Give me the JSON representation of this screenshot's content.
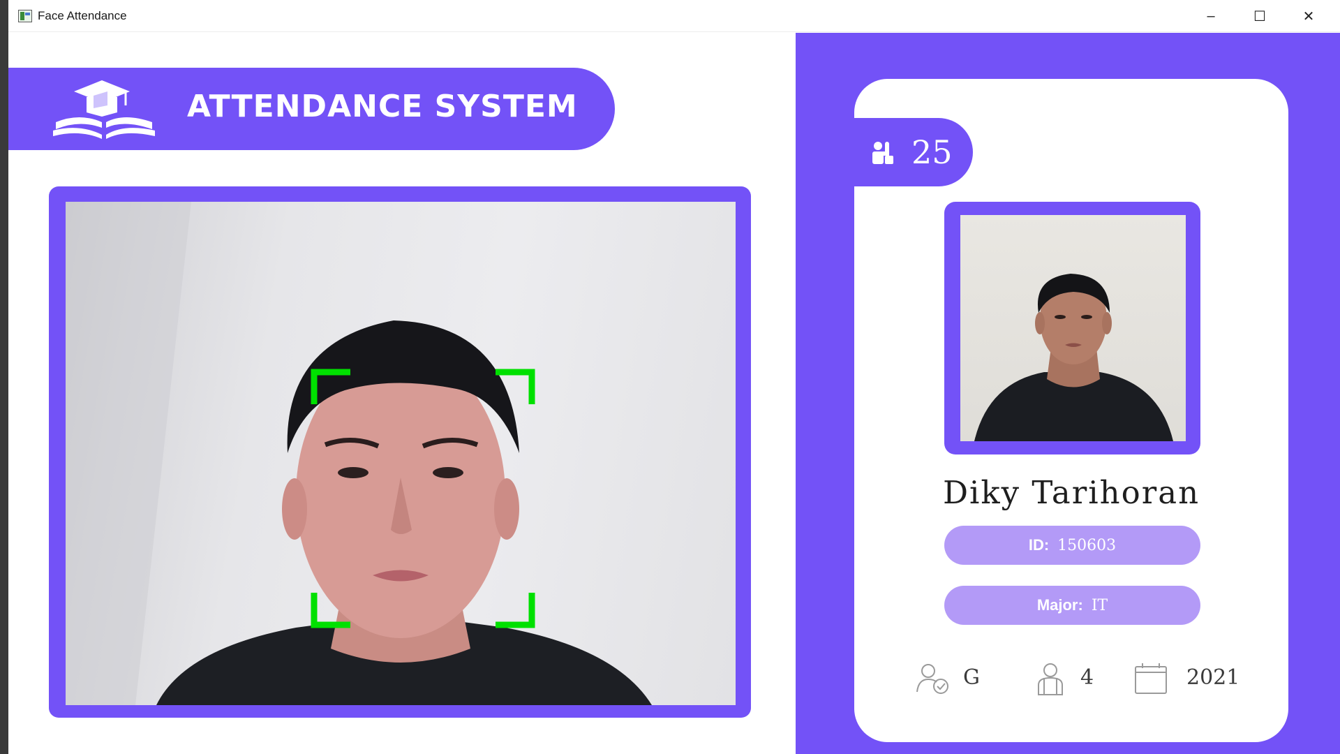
{
  "window": {
    "title": "Face Attendance",
    "controls": {
      "minimize": "–",
      "maximize": "☐",
      "close": "✕"
    }
  },
  "header": {
    "title": "ATTENDANCE SYSTEM",
    "logo_icon": "graduation-book-icon"
  },
  "camera": {
    "face_box_color": "#00e000",
    "detection_state": "face detected"
  },
  "student": {
    "total_attendance": "25",
    "name": "Diky Tarihoran",
    "id_label": "ID:",
    "id_value": "150603",
    "major_label": "Major:",
    "major_value": "IT",
    "standing": "G",
    "year": "4",
    "starting_year": "2021"
  },
  "icons": {
    "attendance": "hand-raise-icon",
    "standing": "user-check-icon",
    "year": "student-icon",
    "starting_year": "calendar-icon"
  },
  "colors": {
    "brand": "#7352f7",
    "pill": "#b39af7",
    "text": "#1e1e1e"
  }
}
